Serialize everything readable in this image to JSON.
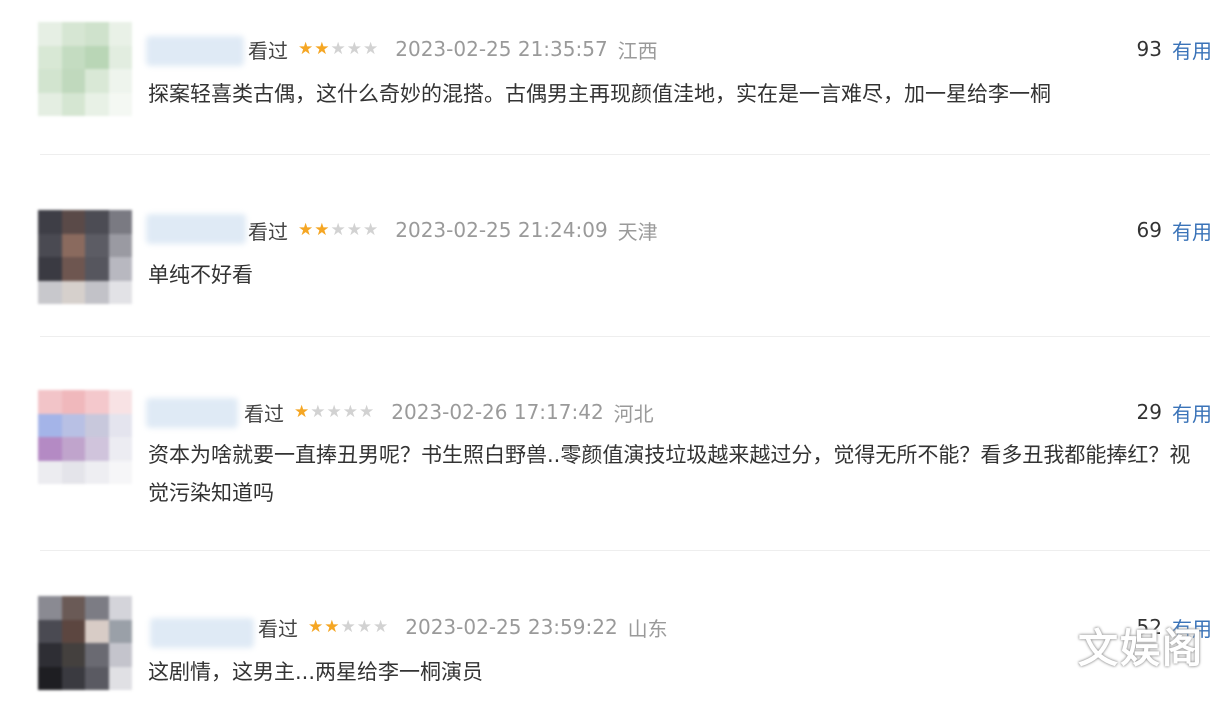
{
  "reviews": [
    {
      "status": "看过",
      "rating": 2,
      "date": "2023-02-25 21:35:57",
      "location": "江西",
      "useful_count": "93",
      "useful_label": "有用",
      "text": "探案轻喜类古偶，这什么奇妙的混搭。古偶男主再现颜值洼地，实在是一言难尽，加一星给李一桐"
    },
    {
      "status": "看过",
      "rating": 2,
      "date": "2023-02-25 21:24:09",
      "location": "天津",
      "useful_count": "69",
      "useful_label": "有用",
      "text": "单纯不好看"
    },
    {
      "status": "看过",
      "rating": 1,
      "date": "2023-02-26 17:17:42",
      "location": "河北",
      "useful_count": "29",
      "useful_label": "有用",
      "text": "资本为啥就要一直捧丑男呢？书生照白野兽..零颜值演技垃圾越来越过分，觉得无所不能？看多丑我都能捧红？视觉污染知道吗"
    },
    {
      "status": "看过",
      "rating": 2,
      "date": "2023-02-25 23:59:22",
      "location": "山东",
      "useful_count": "52",
      "useful_label": "有用",
      "text": "这剧情，这男主...两星给李一桐演员"
    }
  ],
  "watermark": "文娱阁",
  "colors": {
    "star_on": "#f5a623",
    "star_off": "#d2d2d2",
    "useful_link": "#3a73b8"
  }
}
